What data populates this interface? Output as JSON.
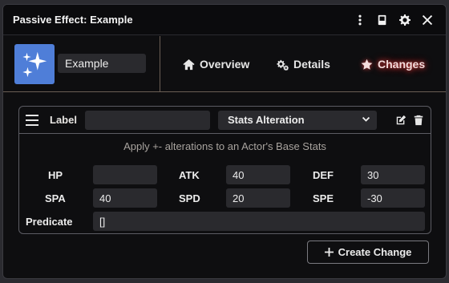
{
  "window": {
    "title": "Passive Effect: Example",
    "controls": [
      "more-vertical-icon",
      "compendium-icon",
      "gear-icon",
      "close-icon"
    ]
  },
  "header": {
    "name": "Example",
    "avatar_icon": "sparkles-icon",
    "avatar_color": "#4f7ed8"
  },
  "nav": {
    "tabs": [
      {
        "label": "Overview",
        "icon": "home-icon"
      },
      {
        "label": "Details",
        "icon": "gears-icon"
      },
      {
        "label": "Changes",
        "icon": "star-icon",
        "active": true
      }
    ]
  },
  "change": {
    "label_caption": "Label",
    "label_value": "",
    "type_selected": "Stats Alteration",
    "hint": "Apply +- alterations to an Actor's Base Stats",
    "stats": [
      {
        "label": "HP",
        "value": ""
      },
      {
        "label": "ATK",
        "value": "40"
      },
      {
        "label": "DEF",
        "value": "30"
      },
      {
        "label": "SPA",
        "value": "40"
      },
      {
        "label": "SPD",
        "value": "20"
      },
      {
        "label": "SPE",
        "value": "-30"
      }
    ],
    "predicate_label": "Predicate",
    "predicate_value": "[]"
  },
  "actions": {
    "create_change": "Create Change"
  },
  "colors": {
    "accent_glow": "#d03a3a",
    "background": "#0e0e10",
    "input_bg": "#2a2a2e"
  }
}
